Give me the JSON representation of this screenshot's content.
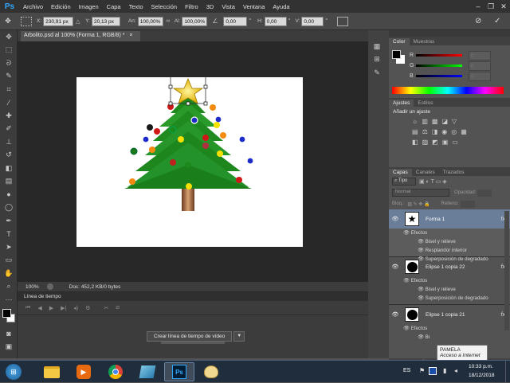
{
  "app": {
    "logo": "Ps"
  },
  "menu": [
    "Archivo",
    "Edición",
    "Imagen",
    "Capa",
    "Texto",
    "Selección",
    "Filtro",
    "3D",
    "Vista",
    "Ventana",
    "Ayuda"
  ],
  "options": {
    "x_label": "X:",
    "x_value": "230,91 px",
    "y_label": "Y:",
    "y_value": "20,13 px",
    "an_label": "An:",
    "an_value": "100,00%",
    "al_label": "Al:",
    "al_value": "100,00%",
    "angle_value": "0,00",
    "h_label": "H:",
    "h_value": "0,00",
    "v_label": "V:",
    "v_value": "0,00"
  },
  "document": {
    "tab_title": "Arbolito.psd al 100% (Forma 1, RGB/8) *",
    "zoom": "100%",
    "doc_info": "Doc: 452,2 KB/0 bytes"
  },
  "timeline": {
    "title": "Línea de tiempo",
    "create_button": "Crear línea de tiempo de vídeo"
  },
  "color_panel": {
    "tabs": [
      "Color",
      "Muestras"
    ],
    "channels": [
      {
        "label": "R",
        "value": "0"
      },
      {
        "label": "G",
        "value": "0"
      },
      {
        "label": "B",
        "value": "0"
      }
    ]
  },
  "adjust_panel": {
    "tabs": [
      "Ajustes",
      "Estilos"
    ],
    "heading": "Añadir un ajuste"
  },
  "layers_panel": {
    "tabs": [
      "Capas",
      "Canales",
      "Trazados"
    ],
    "filter": "Tipo",
    "blend_mode": "Normal",
    "opacity_label": "Opacidad:",
    "lock_label": "Bloq.:",
    "fill_label": "Relleno:",
    "layers": [
      {
        "name": "Forma 1",
        "effects_label": "Efectos",
        "effects": [
          "Bisel y relieve",
          "Resplandor interior",
          "Superposición de degradado"
        ]
      },
      {
        "name": "Elipse 1 copia 22",
        "effects_label": "Efectos",
        "effects": [
          "Bisel y relieve",
          "Superposición de degradado"
        ]
      },
      {
        "name": "Elipse 1 copia 21",
        "effects_label": "Efectos",
        "effects": [
          "Bi"
        ]
      }
    ]
  },
  "tooltip": {
    "title": "PAMELA",
    "subtitle": "Acceso a Internet"
  },
  "taskbar": {
    "language": "ES",
    "time": "10:33 p.m.",
    "date": "18/12/2018"
  },
  "colors": {
    "app_bg": "#535353",
    "accent_blue": "#31a8ff",
    "tree_green": "#1e8a1e",
    "star_yellow": "#f5d100",
    "taskbar": "#1f2d3d"
  }
}
